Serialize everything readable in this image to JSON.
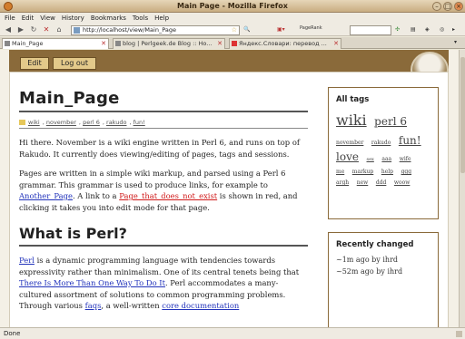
{
  "window": {
    "title": "Main Page - Mozilla Firefox"
  },
  "menu": [
    "File",
    "Edit",
    "View",
    "History",
    "Bookmarks",
    "Tools",
    "Help"
  ],
  "nav": {
    "url": "http://localhost/view/Main_Page",
    "pagerank_label": "PageRank"
  },
  "tabs": [
    {
      "label": "Main_Page",
      "active": true
    },
    {
      "label": "blog | Perlgeek.de Blog :: Ho..."
    },
    {
      "label": "Яндекс.Словари: перевод ..."
    }
  ],
  "page": {
    "buttons": {
      "edit": "Edit",
      "logout": "Log out"
    },
    "title": "Main_Page",
    "tags": [
      "wiki",
      "november",
      "perl 6",
      "rakudo",
      "fun!"
    ],
    "p1": "Hi there. November is a wiki engine written in Perl 6, and runs on top of Rakudo. It currently does viewing/editing of pages, tags and sessions.",
    "p2a": "Pages are written in a simple wiki markup, and parsed using a Perl 6 grammar. This grammar is used to produce links, for example to ",
    "p2_link1": "Another_Page",
    "p2b": ". A link to a ",
    "p2_link2": "Page_that_does_not_exist",
    "p2c": " is shown in red, and clicking it takes you into edit mode for that page.",
    "h2": "What is Perl?",
    "p3_link1": "Perl",
    "p3a": " is a dynamic programming language with tendencies towards expressivity rather than minimalism. One of its central tenets being that ",
    "p3_link2": "There Is More Than One Way To Do It",
    "p3b": ". Perl accommodates a many-cultured assortment of solutions to common programming problems. Through various ",
    "p3_link3": "faqs",
    "p3c": ", a well-written ",
    "p3_link4": "core documentation"
  },
  "sidebar": {
    "all_tags_title": "All tags",
    "cloud": [
      {
        "t": "wiki",
        "s": 16
      },
      {
        "t": "perl 6",
        "s": 12
      },
      {
        "t": "november",
        "s": 6
      },
      {
        "t": "rakudo",
        "s": 6
      },
      {
        "t": "fun!",
        "s": 12
      },
      {
        "t": "love",
        "s": 12
      },
      {
        "t": "sex",
        "s": 5
      },
      {
        "t": "aaa",
        "s": 6
      },
      {
        "t": "wife",
        "s": 6
      },
      {
        "t": "me",
        "s": 6
      },
      {
        "t": "markup",
        "s": 6
      },
      {
        "t": "help",
        "s": 6
      },
      {
        "t": "ggg",
        "s": 6
      },
      {
        "t": "argh",
        "s": 6
      },
      {
        "t": "new",
        "s": 6
      },
      {
        "t": "ddd",
        "s": 6
      },
      {
        "t": "woow",
        "s": 6
      }
    ],
    "recent_title": "Recently changed",
    "recent": [
      "~1m ago by ihrd",
      "~52m ago by ihrd"
    ]
  },
  "status": {
    "text": "Done"
  }
}
